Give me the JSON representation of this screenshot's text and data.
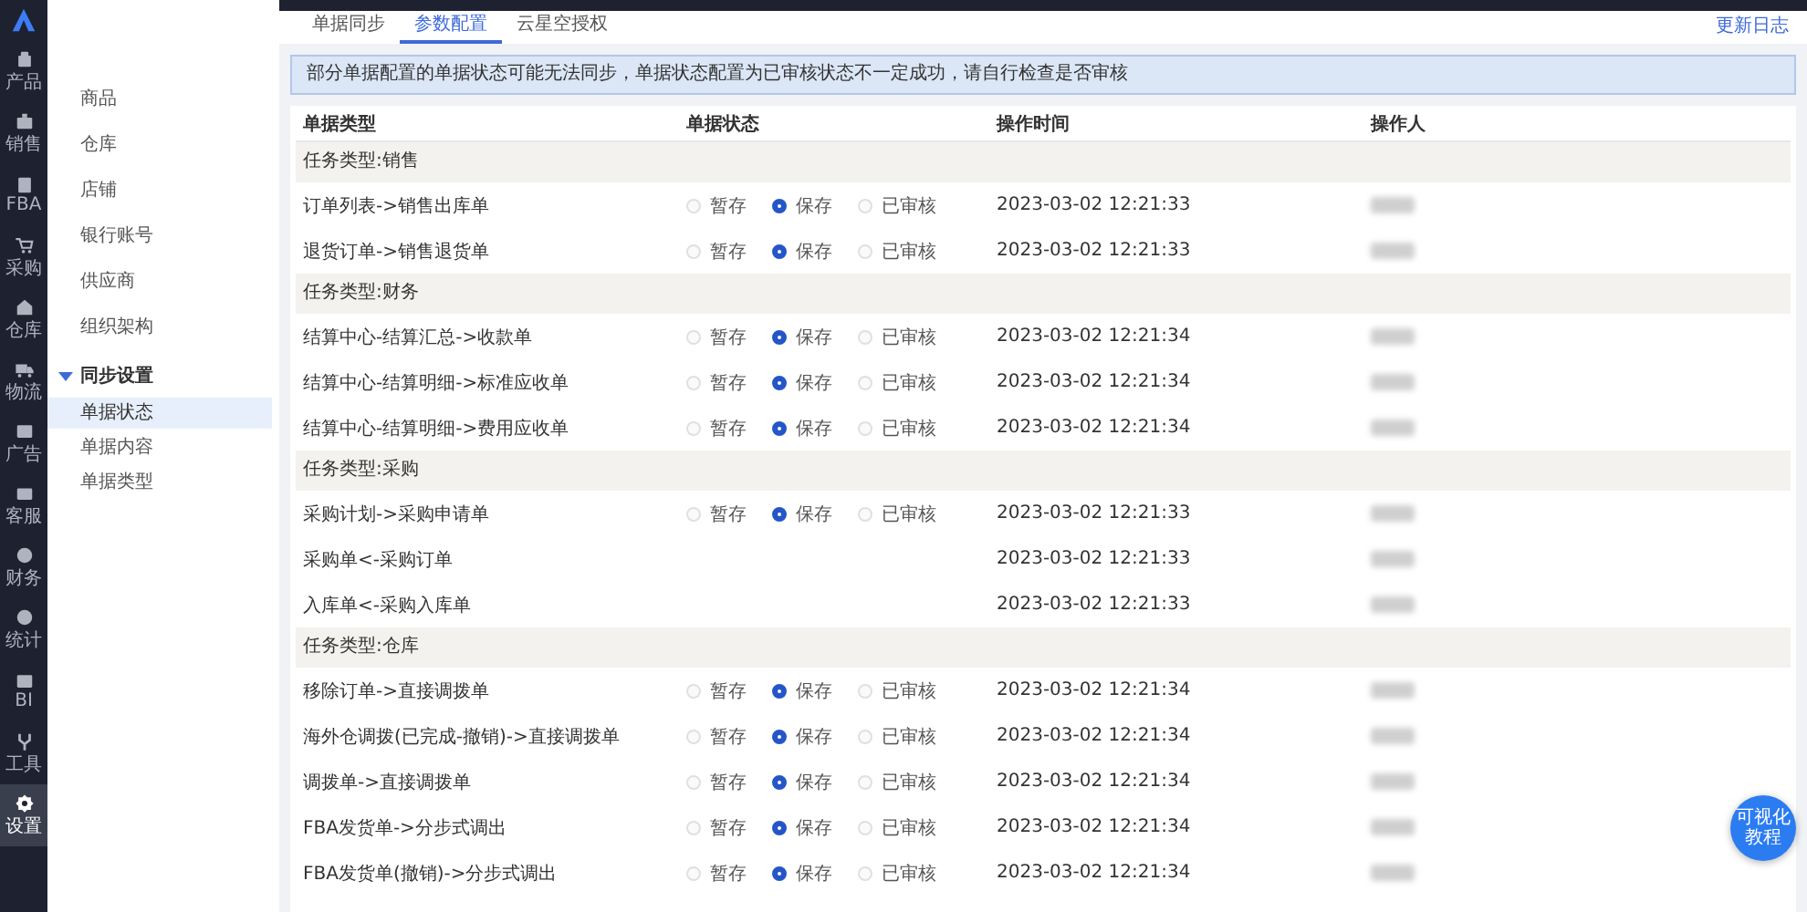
{
  "nav": {
    "items": [
      {
        "label": "产品",
        "selected": false
      },
      {
        "label": "销售",
        "selected": false
      },
      {
        "label": "FBA",
        "selected": false
      },
      {
        "label": "采购",
        "selected": false
      },
      {
        "label": "仓库",
        "selected": false
      },
      {
        "label": "物流",
        "selected": false
      },
      {
        "label": "广告",
        "selected": false
      },
      {
        "label": "客服",
        "selected": false
      },
      {
        "label": "财务",
        "selected": false
      },
      {
        "label": "统计",
        "selected": false
      },
      {
        "label": "BI",
        "selected": false
      },
      {
        "label": "工具",
        "selected": false
      },
      {
        "label": "设置",
        "selected": true
      }
    ]
  },
  "sidebar": {
    "items": [
      {
        "label": "商品",
        "selected": false
      },
      {
        "label": "仓库",
        "selected": false
      },
      {
        "label": "店铺",
        "selected": false
      },
      {
        "label": "银行账号",
        "selected": false
      },
      {
        "label": "供应商",
        "selected": false
      },
      {
        "label": "组织架构",
        "selected": false
      },
      {
        "label": "同步设置",
        "selected": false,
        "expanded": true,
        "children": [
          {
            "label": "单据状态",
            "selected": true
          },
          {
            "label": "单据内容",
            "selected": false
          },
          {
            "label": "单据类型",
            "selected": false
          }
        ]
      }
    ]
  },
  "tabs": [
    {
      "label": "单据同步",
      "selected": false
    },
    {
      "label": "参数配置",
      "selected": true
    },
    {
      "label": "云星空授权",
      "selected": false
    }
  ],
  "changelog_link": "更新日志",
  "notice": "部分单据配置的单据状态可能无法同步，单据状态配置为已审核状态不一定成功，请自行检查是否审核",
  "table": {
    "columns": [
      "单据类型",
      "单据状态",
      "操作时间",
      "操作人"
    ],
    "groups": [
      {
        "title": "任务类型:销售",
        "rows": [
          {
            "name": "订单列表->销售出库单",
            "options": [
              {
                "label": "暂存",
                "selected": false
              },
              {
                "label": "保存",
                "selected": true
              },
              {
                "label": "已审核",
                "selected": false
              }
            ],
            "time": "2023-03-02 12:21:33"
          },
          {
            "name": "退货订单->销售退货单",
            "options": [
              {
                "label": "暂存",
                "selected": false
              },
              {
                "label": "保存",
                "selected": true
              },
              {
                "label": "已审核",
                "selected": false
              }
            ],
            "time": "2023-03-02 12:21:33"
          }
        ]
      },
      {
        "title": "任务类型:财务",
        "rows": [
          {
            "name": "结算中心-结算汇总->收款单",
            "options": [
              {
                "label": "暂存",
                "selected": false
              },
              {
                "label": "保存",
                "selected": true
              },
              {
                "label": "已审核",
                "selected": false
              }
            ],
            "time": "2023-03-02 12:21:34"
          },
          {
            "name": "结算中心-结算明细->标准应收单",
            "options": [
              {
                "label": "暂存",
                "selected": false
              },
              {
                "label": "保存",
                "selected": true
              },
              {
                "label": "已审核",
                "selected": false
              }
            ],
            "time": "2023-03-02 12:21:34"
          },
          {
            "name": "结算中心-结算明细->费用应收单",
            "options": [
              {
                "label": "暂存",
                "selected": false
              },
              {
                "label": "保存",
                "selected": true
              },
              {
                "label": "已审核",
                "selected": false
              }
            ],
            "time": "2023-03-02 12:21:34"
          }
        ]
      },
      {
        "title": "任务类型:采购",
        "rows": [
          {
            "name": "采购计划->采购申请单",
            "options": [
              {
                "label": "暂存",
                "selected": false
              },
              {
                "label": "保存",
                "selected": true
              },
              {
                "label": "已审核",
                "selected": false
              }
            ],
            "time": "2023-03-02 12:21:33"
          },
          {
            "name": "采购单<-采购订单",
            "time": "2023-03-02 12:21:33"
          },
          {
            "name": "入库单<-采购入库单",
            "time": "2023-03-02 12:21:33"
          }
        ]
      },
      {
        "title": "任务类型:仓库",
        "rows": [
          {
            "name": "移除订单->直接调拨单",
            "options": [
              {
                "label": "暂存",
                "selected": false
              },
              {
                "label": "保存",
                "selected": true
              },
              {
                "label": "已审核",
                "selected": false
              }
            ],
            "time": "2023-03-02 12:21:34"
          },
          {
            "name": "海外仓调拨(已完成-撤销)->直接调拨单",
            "options": [
              {
                "label": "暂存",
                "selected": false
              },
              {
                "label": "保存",
                "selected": true
              },
              {
                "label": "已审核",
                "selected": false
              }
            ],
            "time": "2023-03-02 12:21:34"
          },
          {
            "name": "调拨单->直接调拨单",
            "options": [
              {
                "label": "暂存",
                "selected": false
              },
              {
                "label": "保存",
                "selected": true
              },
              {
                "label": "已审核",
                "selected": false
              }
            ],
            "time": "2023-03-02 12:21:34"
          },
          {
            "name": "FBA发货单->分步式调出",
            "options": [
              {
                "label": "暂存",
                "selected": false
              },
              {
                "label": "保存",
                "selected": true
              },
              {
                "label": "已审核",
                "selected": false
              }
            ],
            "time": "2023-03-02 12:21:34"
          },
          {
            "name": "FBA发货单(撤销)->分步式调出",
            "options": [
              {
                "label": "暂存",
                "selected": false
              },
              {
                "label": "保存",
                "selected": true
              },
              {
                "label": "已审核",
                "selected": false
              }
            ],
            "time": "2023-03-02 12:21:34"
          }
        ]
      }
    ]
  },
  "help_button": "可视化教程"
}
